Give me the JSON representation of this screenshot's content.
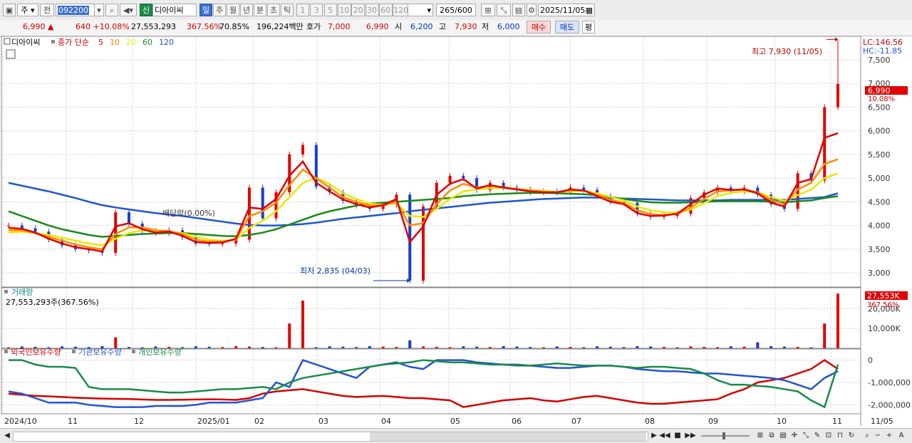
{
  "toolbar": {
    "market": "주",
    "prev": "전",
    "code": "092200",
    "new_badge": "신",
    "stock_name": "디아이씨",
    "periods": [
      "일",
      "주",
      "월",
      "년",
      "분",
      "초",
      "틱"
    ],
    "active_period": "일",
    "intervals": [
      "1",
      "3",
      "5",
      "10",
      "20",
      "30",
      "60",
      "120"
    ],
    "count": "265",
    "count_total": "/600",
    "date": "2025/11/05"
  },
  "quote": {
    "price": "6,990",
    "change": "640",
    "change_pct": "+10.08%",
    "volume": "27,553,293",
    "volume_pct": "367.56%",
    "ratio": "70.85%",
    "amount": "196,224백만",
    "bid_label": "호가",
    "bid": "7,000",
    "ask": "6,990",
    "open_label": "시",
    "open": "6,200",
    "high_label": "고",
    "high": "7,930",
    "low_label": "저",
    "low": "6,000",
    "buy": "매수",
    "sell": "매도",
    "eval": "평"
  },
  "price_panel": {
    "stock_label": "디아이씨",
    "ma_label": "종가 단순",
    "ma_periods": [
      "5",
      "10",
      "20",
      "60",
      "120"
    ],
    "ma_colors": [
      "#e00000",
      "#ff8c00",
      "#e8e800",
      "#1a8a1a",
      "#2255cc"
    ],
    "lc": "LC:146.56",
    "hc": "HC:-11.85",
    "high_annot": "최고 7,930 (11/05)",
    "low_annot": "최저 2,835 (04/03)",
    "div_annot": "배당락(0.00%)",
    "last_price": "6,990",
    "last_pct": "10.08%"
  },
  "volume_panel": {
    "label": "거래량",
    "value": "27,553,293주(367.56%)",
    "last": "27,553K",
    "last_pct": "367.56%"
  },
  "holdings_panel": {
    "labels": [
      "외국인보유수량",
      "기관보유수량",
      "개인보유수량"
    ],
    "colors": [
      "#d40000",
      "#2255cc",
      "#1a8a4a"
    ]
  },
  "x_axis": {
    "labels": [
      "2024/10",
      "11",
      "12",
      "2025/01",
      "02",
      "03",
      "04",
      "05",
      "06",
      "07",
      "08",
      "09",
      "10",
      "11"
    ],
    "last_label": "11/05"
  },
  "chart_data": [
    {
      "type": "candlestick",
      "title": "디아이씨",
      "y_ticks": [
        3000,
        3500,
        4000,
        4500,
        5000,
        5500,
        6000,
        6500,
        7000,
        7500
      ],
      "ylim": [
        2700,
        7950
      ],
      "close": [
        4000,
        3940,
        3870,
        3700,
        3580,
        3500,
        3470,
        3420,
        4280,
        4040,
        3880,
        3840,
        3900,
        3750,
        3620,
        3610,
        3620,
        3700,
        4800,
        4150,
        4700,
        5500,
        5700,
        4820,
        4700,
        4520,
        4420,
        4350,
        4440,
        4650,
        2835,
        4400,
        4900,
        5050,
        5000,
        4750,
        4900,
        4800,
        4760,
        4700,
        4720,
        4700,
        4800,
        4750,
        4620,
        4500,
        4480,
        4250,
        4180,
        4200,
        4250,
        4580,
        4700,
        4800,
        4720,
        4800,
        4650,
        4450,
        4350,
        5100,
        4950,
        6500,
        6990
      ],
      "ma5": [
        3950,
        3930,
        3850,
        3720,
        3620,
        3540,
        3500,
        3450,
        3980,
        4050,
        3920,
        3850,
        3870,
        3780,
        3650,
        3630,
        3640,
        3720,
        4380,
        4350,
        4560,
        5050,
        5350,
        4900,
        4720,
        4550,
        4450,
        4380,
        4430,
        4560,
        3650,
        3980,
        4650,
        4880,
        4980,
        4780,
        4850,
        4800,
        4760,
        4720,
        4700,
        4700,
        4760,
        4740,
        4620,
        4500,
        4450,
        4260,
        4200,
        4210,
        4250,
        4450,
        4650,
        4780,
        4750,
        4760,
        4680,
        4480,
        4400,
        4900,
        4980,
        5850,
        5950
      ],
      "ma10": [
        3900,
        3900,
        3840,
        3760,
        3680,
        3600,
        3540,
        3500,
        3820,
        3960,
        3960,
        3900,
        3880,
        3820,
        3700,
        3660,
        3660,
        3700,
        4200,
        4300,
        4480,
        4850,
        5180,
        5000,
        4800,
        4600,
        4500,
        4420,
        4420,
        4500,
        4000,
        4050,
        4450,
        4740,
        4880,
        4800,
        4840,
        4810,
        4770,
        4740,
        4710,
        4700,
        4740,
        4740,
        4650,
        4540,
        4480,
        4320,
        4240,
        4220,
        4240,
        4380,
        4560,
        4720,
        4740,
        4760,
        4700,
        4540,
        4450,
        4760,
        4900,
        5300,
        5400
      ],
      "ma20": [
        3850,
        3870,
        3840,
        3800,
        3740,
        3680,
        3620,
        3580,
        3720,
        3840,
        3900,
        3880,
        3870,
        3840,
        3760,
        3700,
        3680,
        3700,
        3950,
        4100,
        4300,
        4600,
        4900,
        5000,
        4880,
        4680,
        4560,
        4460,
        4440,
        4470,
        4200,
        4180,
        4350,
        4560,
        4720,
        4760,
        4790,
        4790,
        4770,
        4750,
        4730,
        4710,
        4720,
        4730,
        4680,
        4600,
        4530,
        4400,
        4320,
        4280,
        4270,
        4340,
        4470,
        4620,
        4690,
        4720,
        4700,
        4600,
        4520,
        4640,
        4760,
        5000,
        5100
      ],
      "ma60": [
        4300,
        4200,
        4100,
        4000,
        3920,
        3860,
        3800,
        3760,
        3780,
        3800,
        3820,
        3830,
        3840,
        3840,
        3820,
        3800,
        3780,
        3770,
        3800,
        3850,
        3920,
        4020,
        4120,
        4220,
        4300,
        4360,
        4420,
        4460,
        4480,
        4500,
        4520,
        4540,
        4560,
        4580,
        4620,
        4640,
        4660,
        4670,
        4680,
        4690,
        4690,
        4680,
        4670,
        4660,
        4640,
        4600,
        4560,
        4520,
        4490,
        4480,
        4480,
        4490,
        4500,
        4510,
        4510,
        4510,
        4510,
        4500,
        4490,
        4510,
        4530,
        4580,
        4620
      ],
      "ma120": [
        4900,
        4840,
        4780,
        4720,
        4650,
        4580,
        4500,
        4430,
        4380,
        4340,
        4300,
        4260,
        4230,
        4200,
        4160,
        4120,
        4080,
        4040,
        4010,
        4000,
        4000,
        4010,
        4030,
        4060,
        4100,
        4140,
        4170,
        4200,
        4230,
        4260,
        4300,
        4330,
        4360,
        4390,
        4420,
        4450,
        4480,
        4500,
        4520,
        4540,
        4560,
        4570,
        4580,
        4590,
        4590,
        4580,
        4570,
        4560,
        4550,
        4540,
        4530,
        4530,
        4530,
        4530,
        4540,
        4540,
        4540,
        4540,
        4540,
        4560,
        4580,
        4600,
        4680
      ]
    },
    {
      "type": "bar",
      "title": "거래량",
      "y_ticks": [
        10000,
        20000
      ],
      "y_tick_labels": [
        "10,000K",
        "20,000K"
      ],
      "ylim": [
        0,
        28000
      ],
      "spikes": [
        {
          "x": 8,
          "value": 5500
        },
        {
          "x": 21,
          "value": 12500
        },
        {
          "x": 22,
          "value": 24000
        },
        {
          "x": 30,
          "value": 4000
        },
        {
          "x": 56,
          "value": 3000
        },
        {
          "x": 61,
          "value": 12500
        },
        {
          "x": 62,
          "value": 27553
        }
      ],
      "base_value": 800
    },
    {
      "type": "line",
      "title": "외국인보유수량 / 기관보유수량 / 개인보유수량",
      "y_ticks": [
        0,
        -1000000,
        -2000000
      ],
      "y_tick_labels": [
        "0",
        "-1,000,000",
        "-2,000,000"
      ],
      "ylim": [
        -2400000,
        400000
      ],
      "series": [
        {
          "name": "외국인보유수량",
          "values": [
            -1500000,
            -1550000,
            -1600000,
            -1620000,
            -1650000,
            -1680000,
            -1700000,
            -1720000,
            -1730000,
            -1740000,
            -1760000,
            -1780000,
            -1780000,
            -1770000,
            -1760000,
            -1750000,
            -1760000,
            -1780000,
            -1700000,
            -1500000,
            -1400000,
            -1350000,
            -1300000,
            -1400000,
            -1500000,
            -1600000,
            -1650000,
            -1620000,
            -1600000,
            -1650000,
            -1700000,
            -1700000,
            -1750000,
            -1800000,
            -2100000,
            -2000000,
            -1900000,
            -1800000,
            -1750000,
            -1700000,
            -1800000,
            -1850000,
            -1750000,
            -1650000,
            -1600000,
            -1700000,
            -1800000,
            -1900000,
            -1950000,
            -1950000,
            -1900000,
            -1850000,
            -1800000,
            -1750000,
            -1500000,
            -1300000,
            -1000000,
            -900000,
            -800000,
            -600000,
            -400000,
            0,
            -400000
          ]
        },
        {
          "name": "기관보유수량",
          "values": [
            -1400000,
            -1500000,
            -1700000,
            -1900000,
            -1900000,
            -1900000,
            -2000000,
            -2050000,
            -2100000,
            -2100000,
            -2100000,
            -2050000,
            -2050000,
            -2050000,
            -2000000,
            -1900000,
            -1900000,
            -1900000,
            -1800000,
            -1700000,
            -1000000,
            -1200000,
            0,
            -200000,
            -400000,
            -600000,
            -800000,
            -300000,
            -200000,
            -100000,
            -300000,
            -400000,
            0,
            0,
            0,
            -100000,
            -150000,
            -200000,
            -200000,
            -250000,
            -300000,
            -350000,
            -350000,
            -300000,
            -250000,
            -250000,
            -300000,
            -400000,
            -450000,
            -500000,
            -500000,
            -550000,
            -600000,
            -600000,
            -650000,
            -700000,
            -750000,
            -800000,
            -900000,
            -1100000,
            -1300000,
            -800000,
            -500000
          ]
        },
        {
          "name": "개인보유수량",
          "values": [
            0,
            0,
            -200000,
            -300000,
            -300000,
            -350000,
            -1200000,
            -1300000,
            -1300000,
            -1300000,
            -1350000,
            -1400000,
            -1450000,
            -1450000,
            -1400000,
            -1350000,
            -1300000,
            -1300000,
            -1250000,
            -1200000,
            -1300000,
            -1000000,
            -800000,
            -700000,
            -600000,
            -500000,
            -400000,
            -300000,
            -200000,
            -150000,
            -100000,
            0,
            -50000,
            -100000,
            -100000,
            -150000,
            -200000,
            -200000,
            -250000,
            -250000,
            -200000,
            -150000,
            -200000,
            -250000,
            -250000,
            -250000,
            -300000,
            -350000,
            -300000,
            -300000,
            -350000,
            -400000,
            -600000,
            -900000,
            -1100000,
            -1100000,
            -1150000,
            -1200000,
            -1300000,
            -1400000,
            -1800000,
            -2100000,
            -200000
          ]
        }
      ]
    }
  ],
  "statusbar": {
    "btn_play": "▶",
    "btn_rew": "◀◀",
    "btn_stop": "■",
    "btn_ff": "▶▶",
    "zoom_minus": "−",
    "zoom_plus": "+",
    "text_a": "A"
  }
}
